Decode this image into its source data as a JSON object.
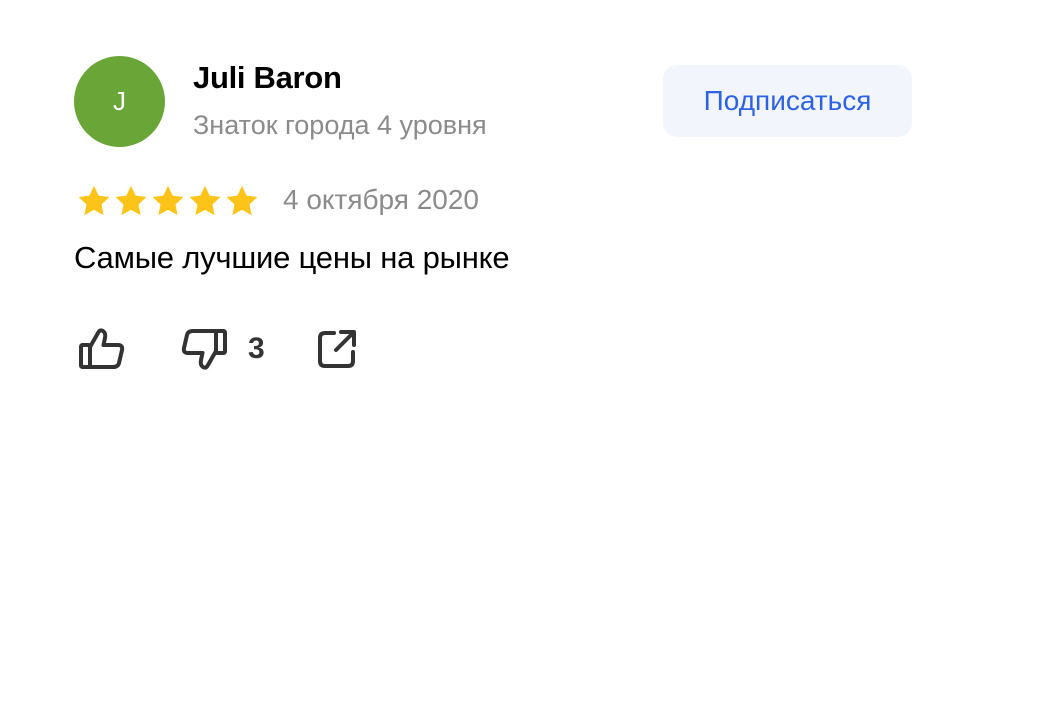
{
  "review": {
    "author": {
      "initial": "J",
      "name": "Juli Baron",
      "level": "Знаток города 4 уровня",
      "avatar_color": "#6aa537"
    },
    "subscribe_label": "Подписаться",
    "rating": 5,
    "date": "4 октября 2020",
    "text": "Самые лучшие цены на рынке",
    "reactions": {
      "likes_icon": "thumbs-up-icon",
      "dislikes_icon": "thumbs-down-icon",
      "dislike_count": "3",
      "share_icon": "share-icon"
    }
  },
  "colors": {
    "star": "#fcc419",
    "accent": "#2e62e6",
    "button_bg": "#f2f5fc",
    "muted_text": "#8b8b8b"
  }
}
